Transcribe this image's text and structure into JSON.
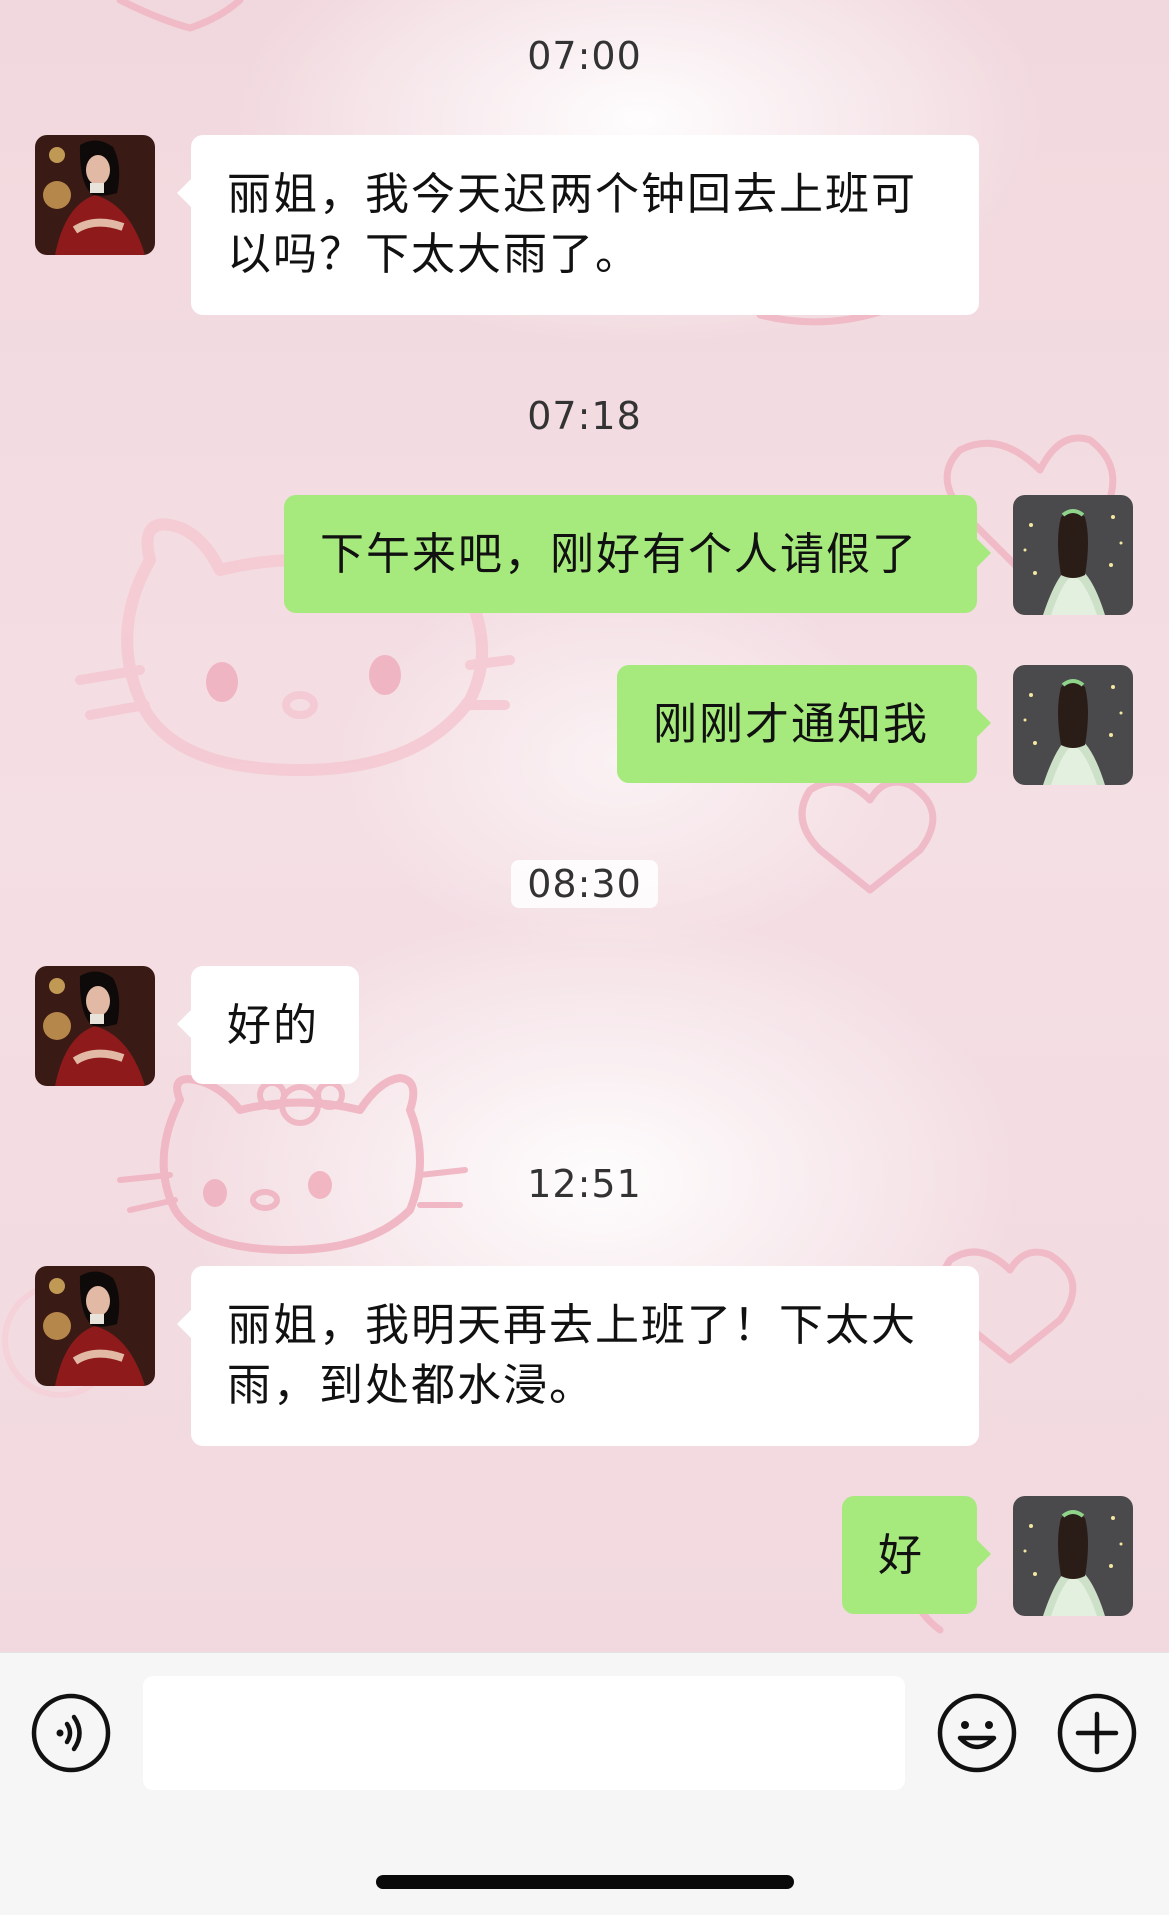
{
  "messages": [
    {
      "time": "07:00",
      "sender": "contact",
      "text": "丽姐，我今天迟两个钟回去上班可以吗？下太大雨了。",
      "lines": [
        "丽姐，我今天迟两个钟回去上班可",
        "以吗？下太大雨了。"
      ]
    },
    {
      "time": "07:18",
      "sender": "me",
      "text": "下午来吧，刚好有个人请假了"
    },
    {
      "sender": "me",
      "text": "刚刚才通知我"
    },
    {
      "time": "08:30",
      "sender": "contact",
      "text": "好的"
    },
    {
      "time": "12:51",
      "sender": "contact",
      "text": "丽姐，我明天再去上班了！下太大雨，到处都水浸。",
      "lines": [
        "丽姐，我明天再去上班了！下太大",
        "雨，到处都水浸。"
      ]
    },
    {
      "sender": "me",
      "text": "好"
    }
  ],
  "input_bar": {
    "placeholder": "",
    "value": "",
    "icons": [
      "voice-icon",
      "emoji-icon",
      "plus-icon"
    ]
  },
  "colors": {
    "outgoing_bubble": "#a6e97d",
    "incoming_bubble": "#ffffff",
    "background": "#f3dfe3"
  }
}
